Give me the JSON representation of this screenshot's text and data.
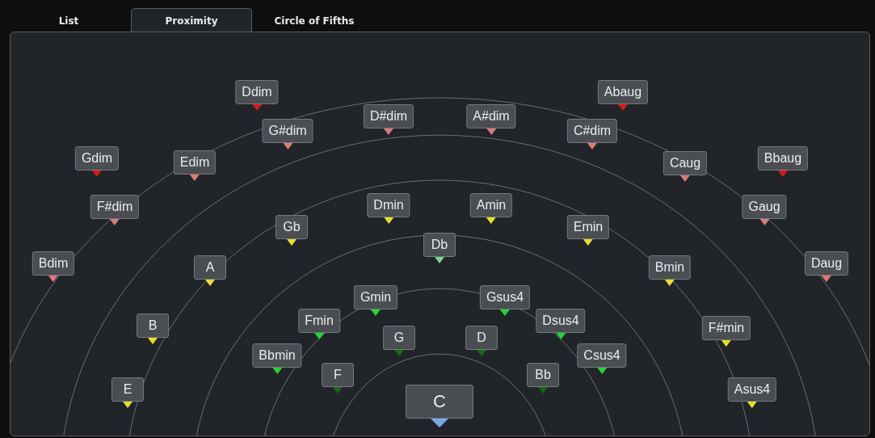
{
  "tabs": [
    {
      "label": "List",
      "selected": false
    },
    {
      "label": "Proximity",
      "selected": true
    },
    {
      "label": "Circle of Fifths",
      "selected": false
    }
  ],
  "chords": [
    {
      "label": "Ddim",
      "color": "#e01515"
    },
    {
      "label": "Abaug",
      "color": "#e01515"
    },
    {
      "label": "D#dim",
      "color": "#e07878"
    },
    {
      "label": "A#dim",
      "color": "#e07878"
    },
    {
      "label": "G#dim",
      "color": "#e07878"
    },
    {
      "label": "C#dim",
      "color": "#e07878"
    },
    {
      "label": "Gdim",
      "color": "#e01515"
    },
    {
      "label": "Edim",
      "color": "#e07878"
    },
    {
      "label": "Caug",
      "color": "#e07878"
    },
    {
      "label": "Bbaug",
      "color": "#e01515"
    },
    {
      "label": "F#dim",
      "color": "#e07878"
    },
    {
      "label": "Dmin",
      "color": "#e8e020"
    },
    {
      "label": "Amin",
      "color": "#e8e020"
    },
    {
      "label": "Gaug",
      "color": "#e07878"
    },
    {
      "label": "Gb",
      "color": "#e8e020"
    },
    {
      "label": "Emin",
      "color": "#e8e020"
    },
    {
      "label": "Db",
      "color": "#70d890"
    },
    {
      "label": "Bdim",
      "color": "#e07878"
    },
    {
      "label": "A",
      "color": "#e8e020"
    },
    {
      "label": "Bmin",
      "color": "#e8e020"
    },
    {
      "label": "Daug",
      "color": "#e07878"
    },
    {
      "label": "Gmin",
      "color": "#20d830"
    },
    {
      "label": "Gsus4",
      "color": "#20d830"
    },
    {
      "label": "B",
      "color": "#e8e020"
    },
    {
      "label": "Fmin",
      "color": "#20d830"
    },
    {
      "label": "Dsus4",
      "color": "#20d830"
    },
    {
      "label": "F#min",
      "color": "#e8e020"
    },
    {
      "label": "G",
      "color": "#156a15"
    },
    {
      "label": "D",
      "color": "#156a15"
    },
    {
      "label": "Bbmin",
      "color": "#20d830"
    },
    {
      "label": "Csus4",
      "color": "#20d830"
    },
    {
      "label": "F",
      "color": "#156a15"
    },
    {
      "label": "Bb",
      "color": "#156a15"
    },
    {
      "label": "E",
      "color": "#e8e020"
    },
    {
      "label": "C",
      "color": "#7aa8e0",
      "kind": "root"
    },
    {
      "label": "Asus4",
      "color": "#e8e020"
    }
  ]
}
